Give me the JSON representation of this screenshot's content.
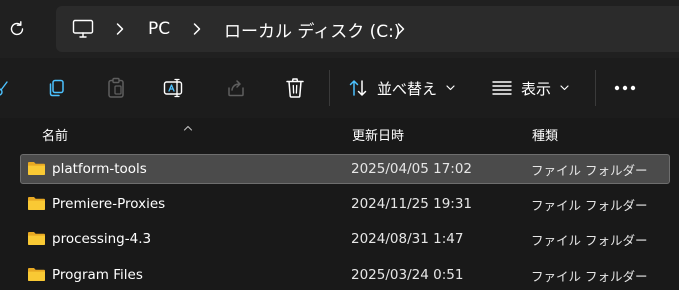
{
  "address": {
    "path": [
      "PC",
      "ローカル ディスク (C:)"
    ]
  },
  "toolbar": {
    "sort_label": "並べ替え",
    "view_label": "表示"
  },
  "columns": {
    "name": "名前",
    "date": "更新日時",
    "type": "種類"
  },
  "files": [
    {
      "name": "platform-tools",
      "date": "2025/04/05 17:02",
      "type": "ファイル フォルダー",
      "selected": true
    },
    {
      "name": "Premiere-Proxies",
      "date": "2024/11/25 19:31",
      "type": "ファイル フォルダー",
      "selected": false
    },
    {
      "name": "processing-4.3",
      "date": "2024/08/31 1:47",
      "type": "ファイル フォルダー",
      "selected": false
    },
    {
      "name": "Program Files",
      "date": "2025/03/24 0:51",
      "type": "ファイル フォルダー",
      "selected": false
    }
  ],
  "colors": {
    "accent_blue": "#4cc2ff",
    "folder_yellow": "#f9c934",
    "selected_bg": "#4b4b4b"
  }
}
